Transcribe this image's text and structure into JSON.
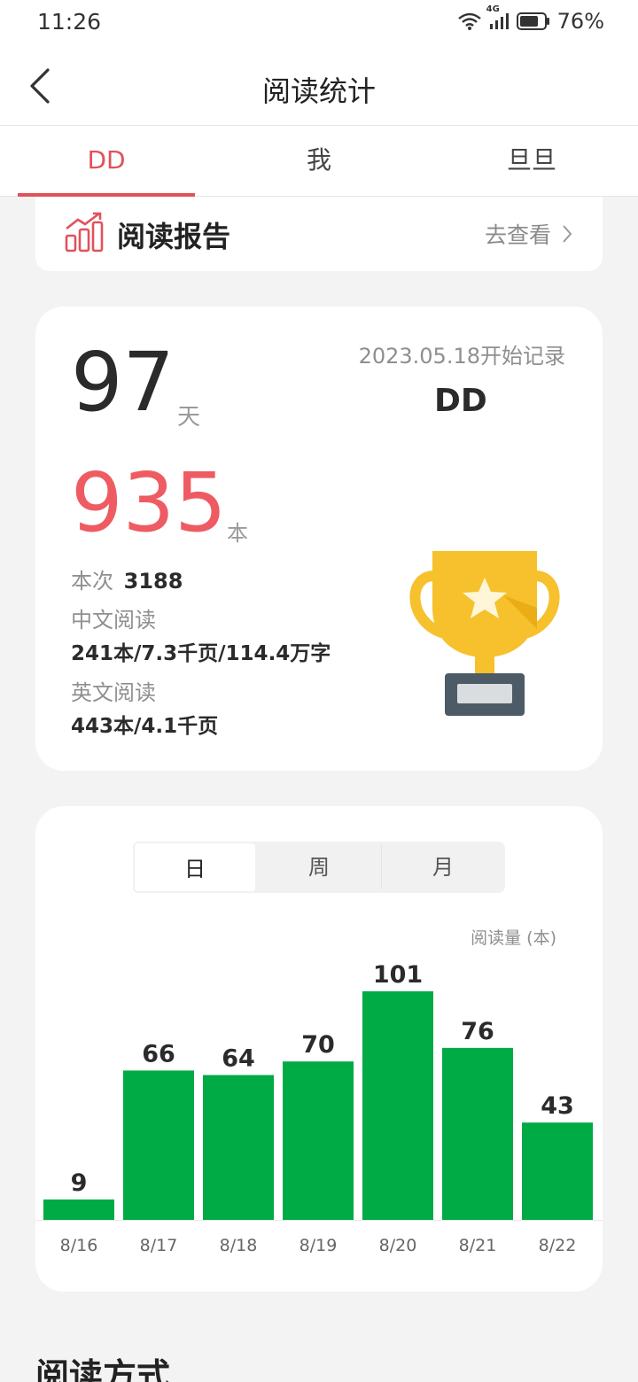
{
  "status_bar": {
    "time": "11:26",
    "network": "4G",
    "battery": "76%"
  },
  "header": {
    "title": "阅读统计"
  },
  "tabs": [
    {
      "label": "DD",
      "active": true
    },
    {
      "label": "我",
      "active": false
    },
    {
      "label": "旦旦",
      "active": false
    }
  ],
  "report": {
    "label": "阅读报告",
    "action": "去查看"
  },
  "stats": {
    "days": "97",
    "days_unit": "天",
    "start_note": "2023.05.18开始记录",
    "reader": "DD",
    "books": "935",
    "books_unit": "本",
    "count_label": "本次",
    "count_value": "3188",
    "chinese_label": "中文阅读",
    "chinese_value": "241本/7.3千页/114.4万字",
    "english_label": "英文阅读",
    "english_value": "443本/4.1千页"
  },
  "period_selector": {
    "options": [
      "日",
      "周",
      "月"
    ],
    "selected": "日"
  },
  "chart_data": {
    "type": "bar",
    "ylabel": "阅读量 (本)",
    "categories": [
      "8/16",
      "8/17",
      "8/18",
      "8/19",
      "8/20",
      "8/21",
      "8/22"
    ],
    "values": [
      9,
      66,
      64,
      70,
      101,
      76,
      43
    ],
    "bar_color": "#00aa44",
    "grid": false
  },
  "section": {
    "title": "阅读方式"
  },
  "colors": {
    "accent": "#e0525a",
    "big_number_red": "#ee5b62",
    "bar_green": "#00aa44",
    "trophy_gold": "#f6c12c"
  }
}
